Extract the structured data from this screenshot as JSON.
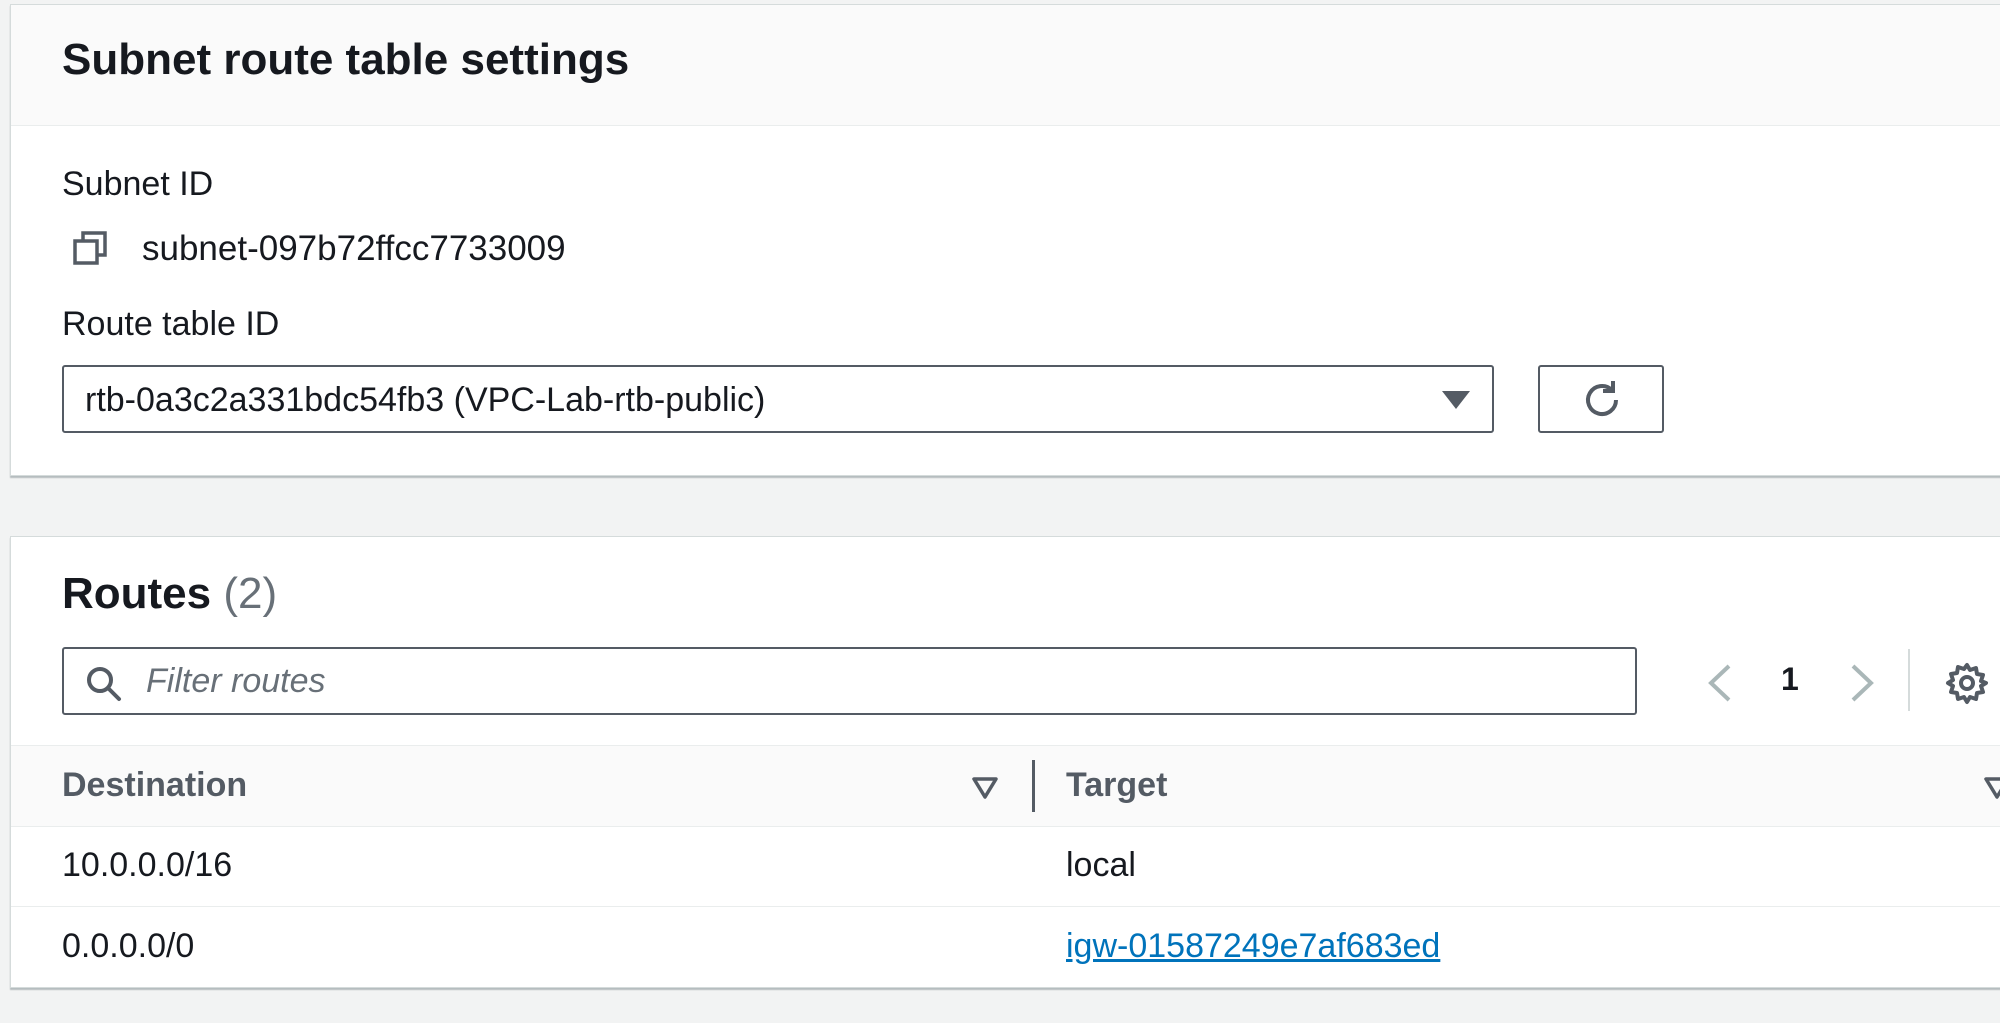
{
  "settings": {
    "title": "Subnet route table settings",
    "subnet_label": "Subnet ID",
    "subnet_value": "subnet-097b72ffcc7733009",
    "route_table_label": "Route table ID",
    "route_table_selected": "rtb-0a3c2a331bdc54fb3 (VPC-Lab-rtb-public)"
  },
  "routes": {
    "title": "Routes",
    "count": "(2)",
    "filter_placeholder": "Filter routes",
    "filter_value": "",
    "current_page": "1",
    "columns": {
      "destination": "Destination",
      "target": "Target"
    },
    "rows": [
      {
        "destination": "10.0.0.0/16",
        "target": "local",
        "target_is_link": false
      },
      {
        "destination": "0.0.0.0/0",
        "target": "igw-01587249e7af683ed",
        "target_is_link": true
      }
    ]
  },
  "colors": {
    "link": "#0073bb",
    "border": "#545b64",
    "background": "#f2f3f3",
    "muted_text": "#687078"
  },
  "icons": [
    "copy-icon",
    "chevron-down-icon",
    "refresh-icon",
    "search-icon",
    "chevron-left-icon",
    "chevron-right-icon",
    "gear-icon",
    "sort-icon"
  ]
}
